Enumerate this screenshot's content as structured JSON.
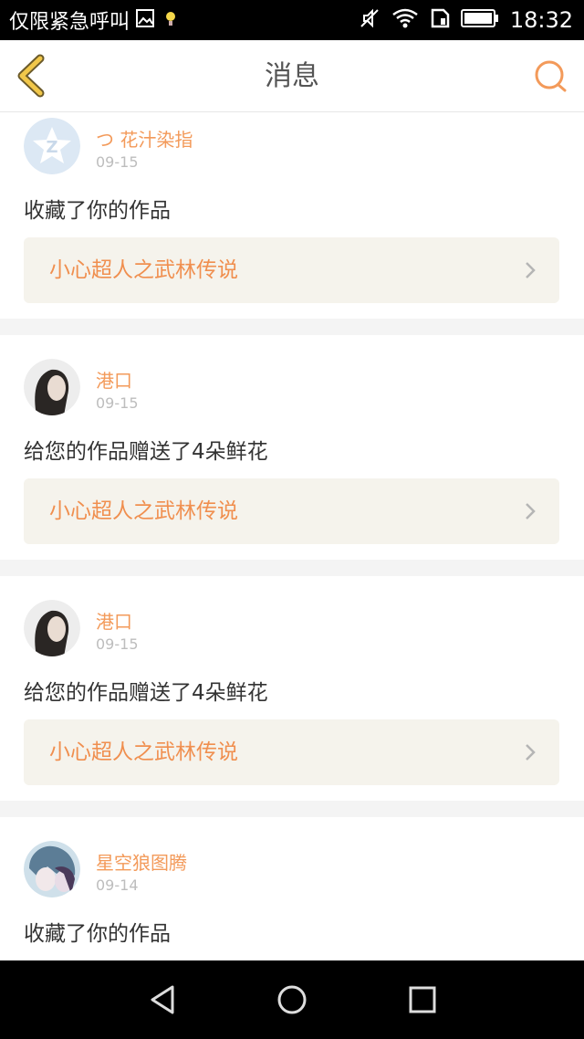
{
  "status_bar": {
    "carrier": "仅限紧急呼叫",
    "time": "18:32",
    "icons": [
      "image-icon",
      "bulb-icon",
      "mute-icon",
      "wifi-icon",
      "sim-icon",
      "battery-icon"
    ]
  },
  "header": {
    "title": "消息",
    "back_icon": "back-chevron-icon",
    "search_icon": "search-icon"
  },
  "messages": [
    {
      "user": "つ 花汁染指",
      "date": "09-15",
      "text": "收藏了你的作品",
      "work": "小心超人之武林传说",
      "avatar": "qq-default-avatar"
    },
    {
      "user": "港口",
      "date": "09-15",
      "text": "给您的作品赠送了4朵鲜花",
      "work": "小心超人之武林传说",
      "avatar": "portrait-avatar"
    },
    {
      "user": "港口",
      "date": "09-15",
      "text": "给您的作品赠送了4朵鲜花",
      "work": "小心超人之武林传说",
      "avatar": "portrait-avatar"
    },
    {
      "user": "星空狼图腾",
      "date": "09-14",
      "text": "收藏了你的作品",
      "avatar": "anime-avatar"
    }
  ],
  "nav_bar": [
    "back-triangle-icon",
    "home-circle-icon",
    "recents-square-icon"
  ],
  "colors": {
    "accent": "#f39a5a",
    "work_text": "#f08f4f",
    "link_bg": "#f5f3ec",
    "page_bg": "#f4f4f4",
    "back_icon": "#f1c74a"
  }
}
